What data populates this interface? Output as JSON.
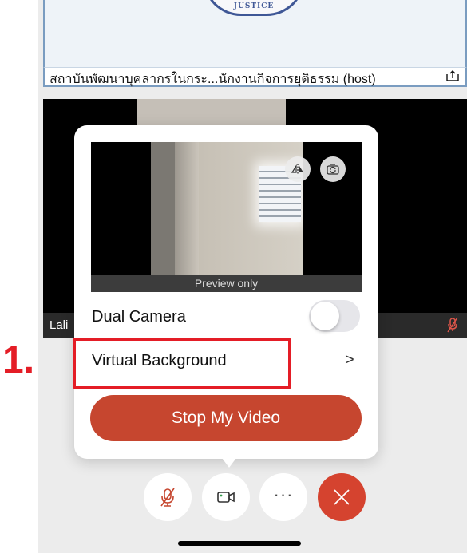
{
  "host": {
    "name_label": "สถาบันพัฒนาบุคลากรในกระ...นักงานกิจการยุติธรรม (host)",
    "logo_text": "JUSTICE"
  },
  "participant": {
    "name": "Lali"
  },
  "popup": {
    "preview_caption": "Preview only",
    "dual_camera_label": "Dual Camera",
    "dual_camera_on": false,
    "virtual_background_label": "Virtual Background",
    "virtual_background_chevron": ">",
    "stop_video_label": "Stop My Video"
  },
  "annotation": {
    "step_label": "1."
  },
  "toolbar": {
    "more_label": "···"
  },
  "colors": {
    "accent_red": "#c6462f",
    "annotation_red": "#e41d26",
    "leave_red": "#d5432f"
  },
  "icons": [
    "share-icon",
    "mic-muted-icon",
    "mirror-icon",
    "switch-camera-icon",
    "video-camera-icon",
    "more-icon",
    "close-icon"
  ]
}
